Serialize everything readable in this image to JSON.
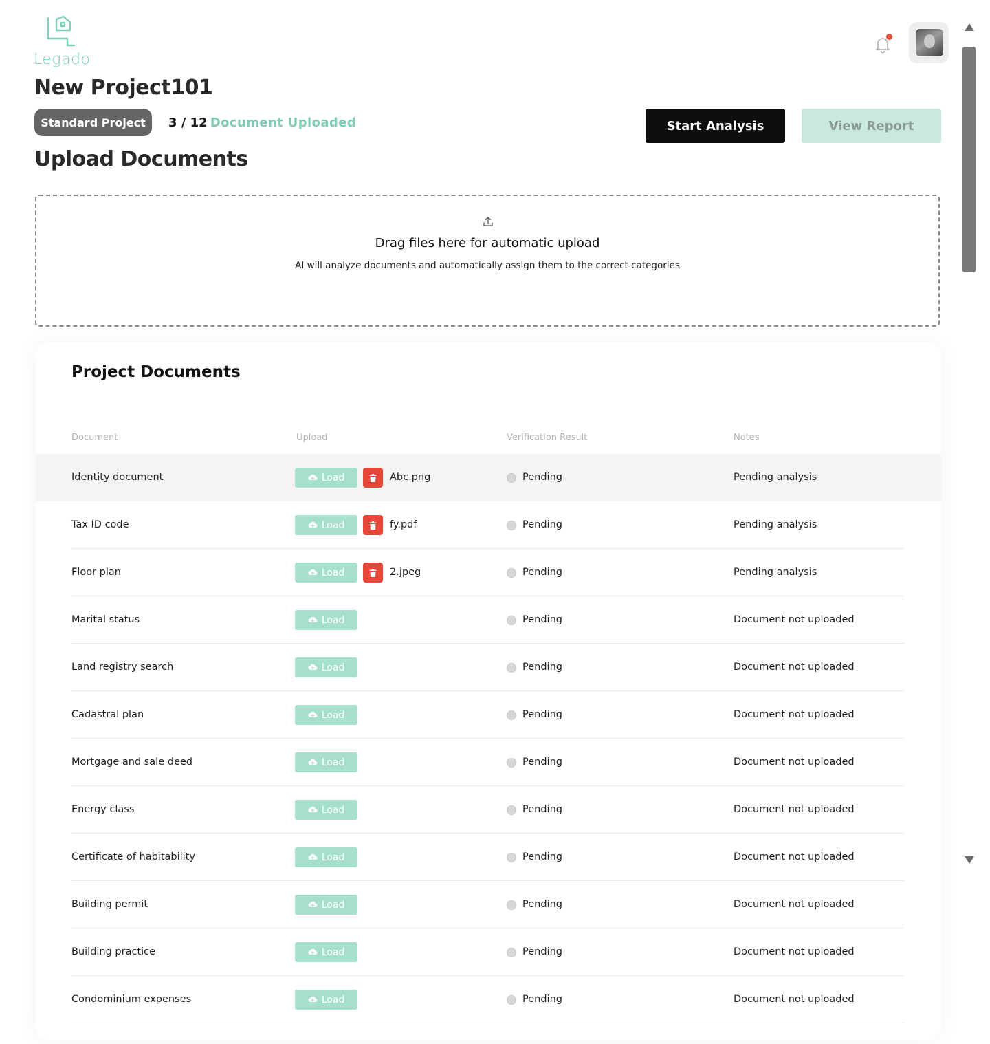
{
  "brand": {
    "name": "Legado",
    "accent": "#7fcfb8"
  },
  "header": {
    "notification_icon": "bell-icon",
    "has_unread": true
  },
  "project": {
    "title": "New Project101",
    "type_badge": "Standard Project",
    "count": "3 / 12",
    "count_label": "Document Uploaded"
  },
  "actions": {
    "start_label": "Start Analysis",
    "report_label": "View Report"
  },
  "upload": {
    "heading": "Upload Documents",
    "dropzone_title": "Drag files here for automatic upload",
    "dropzone_subtitle": "AI will analyze documents and automatically assign them to the correct categories"
  },
  "documents": {
    "title": "Project Documents",
    "columns": [
      "Document",
      "Upload",
      "Verification Result",
      "Notes"
    ],
    "load_label": "Load",
    "rows": [
      {
        "name": "Identity document",
        "file": "Abc.png",
        "status": "Pending",
        "note": "Pending analysis"
      },
      {
        "name": "Tax ID code",
        "file": "fy.pdf",
        "status": "Pending",
        "note": "Pending analysis"
      },
      {
        "name": "Floor plan",
        "file": "2.jpeg",
        "status": "Pending",
        "note": "Pending analysis"
      },
      {
        "name": "Marital status",
        "file": "",
        "status": "Pending",
        "note": "Document not uploaded"
      },
      {
        "name": "Land registry search",
        "file": "",
        "status": "Pending",
        "note": "Document not uploaded"
      },
      {
        "name": "Cadastral plan",
        "file": "",
        "status": "Pending",
        "note": "Document not uploaded"
      },
      {
        "name": "Mortgage and sale deed",
        "file": "",
        "status": "Pending",
        "note": "Document not uploaded"
      },
      {
        "name": "Energy class",
        "file": "",
        "status": "Pending",
        "note": "Document not uploaded"
      },
      {
        "name": "Certificate of habitability",
        "file": "",
        "status": "Pending",
        "note": "Document not uploaded"
      },
      {
        "name": "Building permit",
        "file": "",
        "status": "Pending",
        "note": "Document not uploaded"
      },
      {
        "name": "Building practice",
        "file": "",
        "status": "Pending",
        "note": "Document not uploaded"
      },
      {
        "name": "Condominium expenses",
        "file": "",
        "status": "Pending",
        "note": "Document not uploaded"
      }
    ]
  }
}
